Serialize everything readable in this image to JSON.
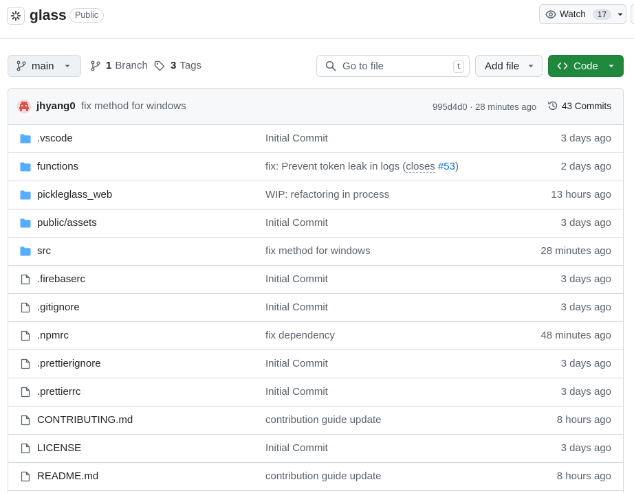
{
  "repo": {
    "name": "glass",
    "visibility": "Public",
    "watch_label": "Watch",
    "watch_count": "17"
  },
  "toolbar": {
    "branch": "main",
    "branch_count": "1",
    "branch_label": "Branch",
    "tag_count": "3",
    "tag_label": "Tags",
    "goto_placeholder": "Go to file",
    "goto_shortcut": "t",
    "add_file_label": "Add file",
    "code_label": "Code"
  },
  "latest_commit": {
    "author": "jhyang0",
    "message": "fix method for windows",
    "meta": "995d4d0 · 28 minutes ago",
    "commits_label": "43 Commits"
  },
  "files": [
    {
      "name": ".vscode",
      "type": "dir",
      "message": "Initial Commit",
      "age": "3 days ago"
    },
    {
      "name": "functions",
      "type": "dir",
      "message": "fix: Prevent token leak in logs (",
      "closes": "closes",
      "issue": "#53",
      "message_end": ")",
      "age": "2 days ago"
    },
    {
      "name": "pickleglass_web",
      "type": "dir",
      "message": "WIP: refactoring in process",
      "age": "13 hours ago"
    },
    {
      "name": "public/assets",
      "type": "dir",
      "message": "Initial Commit",
      "age": "3 days ago"
    },
    {
      "name": "src",
      "type": "dir",
      "message": "fix method for windows",
      "age": "28 minutes ago"
    },
    {
      "name": ".firebaserc",
      "type": "file",
      "message": "Initial Commit",
      "age": "3 days ago"
    },
    {
      "name": ".gitignore",
      "type": "file",
      "message": "Initial Commit",
      "age": "3 days ago"
    },
    {
      "name": ".npmrc",
      "type": "file",
      "message": "fix dependency",
      "age": "48 minutes ago"
    },
    {
      "name": ".prettierignore",
      "type": "file",
      "message": "Initial Commit",
      "age": "3 days ago"
    },
    {
      "name": ".prettierrc",
      "type": "file",
      "message": "Initial Commit",
      "age": "3 days ago"
    },
    {
      "name": "CONTRIBUTING.md",
      "type": "file",
      "message": "contribution guide update",
      "age": "8 hours ago"
    },
    {
      "name": "LICENSE",
      "type": "file",
      "message": "Initial Commit",
      "age": "3 days ago"
    },
    {
      "name": "README.md",
      "type": "file",
      "message": "contribution guide update",
      "age": "8 hours ago"
    }
  ],
  "colors": {
    "folder": "#54aeff",
    "file_icon": "#59636e",
    "accent_green": "#1f883d",
    "link": "#0969da"
  }
}
